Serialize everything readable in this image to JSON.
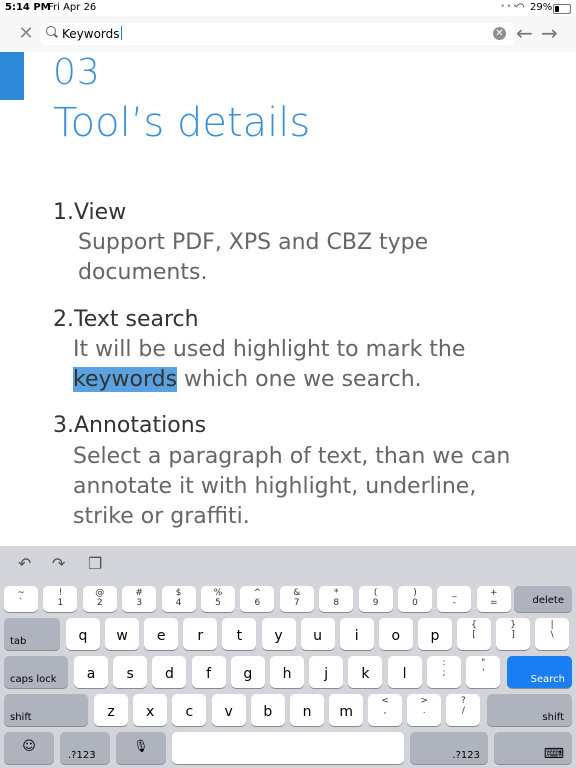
{
  "status": {
    "time": "5:14 PM",
    "date": "Fri Apr 26",
    "battery": "29%"
  },
  "search": {
    "query": "Keywords"
  },
  "doc": {
    "number": "03",
    "title": "Tool’s details",
    "items": [
      {
        "heading": "1.View",
        "text": [
          "Support PDF, XPS and CBZ type",
          "documents."
        ]
      },
      {
        "heading": "2.Text search",
        "line1_before": "It will be used  highlight to mark the",
        "highlight": "keywords",
        "line2_after": " which one we search."
      },
      {
        "heading": "3.Annotations",
        "text": [
          "Select a paragraph of text, than we can",
          "annotate it with highlight, underline,",
          "strike or graffiti."
        ]
      }
    ]
  },
  "keyboard": {
    "row0": [
      [
        "~",
        "`"
      ],
      [
        "!",
        "1"
      ],
      [
        "@",
        "2"
      ],
      [
        "#",
        "3"
      ],
      [
        "$",
        "4"
      ],
      [
        "%",
        "5"
      ],
      [
        "^",
        "6"
      ],
      [
        "&",
        "7"
      ],
      [
        "*",
        "8"
      ],
      [
        "(",
        "9"
      ],
      [
        ")",
        "0"
      ],
      [
        "_",
        "-"
      ],
      [
        "+",
        "="
      ]
    ],
    "delete": "delete",
    "tab": "tab",
    "row1": [
      "q",
      "w",
      "e",
      "r",
      "t",
      "y",
      "u",
      "i",
      "o",
      "p"
    ],
    "row1_extra": [
      [
        "{",
        "["
      ],
      [
        "}",
        "]"
      ],
      [
        "|",
        "\\"
      ]
    ],
    "caps": "caps lock",
    "row2": [
      "a",
      "s",
      "d",
      "f",
      "g",
      "h",
      "j",
      "k",
      "l"
    ],
    "row2_extra": [
      [
        ":",
        ";"
      ],
      [
        "\"",
        "'"
      ]
    ],
    "search": "Search",
    "shift": "shift",
    "row3": [
      "z",
      "x",
      "c",
      "v",
      "b",
      "n",
      "m"
    ],
    "row3_extra": [
      [
        "<",
        ","
      ],
      [
        ">",
        "."
      ],
      [
        "?",
        "/"
      ]
    ],
    "num_label": ".?123"
  }
}
